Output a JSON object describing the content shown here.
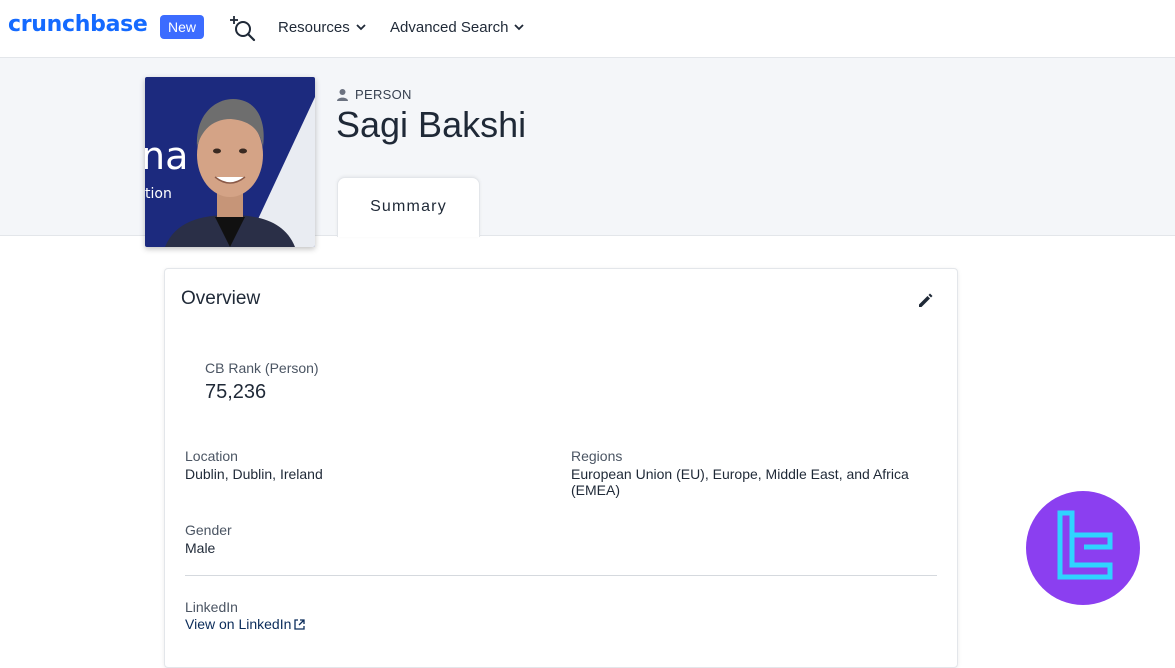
{
  "nav": {
    "logo_text": "crunchbase",
    "new_badge": "New",
    "search_icon": "search-plus-icon",
    "resources_label": "Resources",
    "advanced_search_label": "Advanced Search"
  },
  "profile": {
    "type_label": "PERSON",
    "name": "Sagi Bakshi",
    "tab_label": "Summary"
  },
  "overview": {
    "title": "Overview",
    "rank_label": "CB Rank (Person)",
    "rank_value": "75,236",
    "location_label": "Location",
    "location_value": "Dublin, Dublin, Ireland",
    "regions_label": "Regions",
    "regions_value": "European Union (EU), Europe, Middle East, and Africa (EMEA)",
    "gender_label": "Gender",
    "gender_value": "Male",
    "linkedin_label": "LinkedIn",
    "linkedin_link": "View on LinkedIn"
  },
  "photo_backdrop_text": {
    "big": "na",
    "small": "tion"
  },
  "colors": {
    "brand": "#146aff",
    "badge": "#3c6cff",
    "watermark": "#8b3ff0",
    "watermark_mark": "#2fd3ff"
  }
}
